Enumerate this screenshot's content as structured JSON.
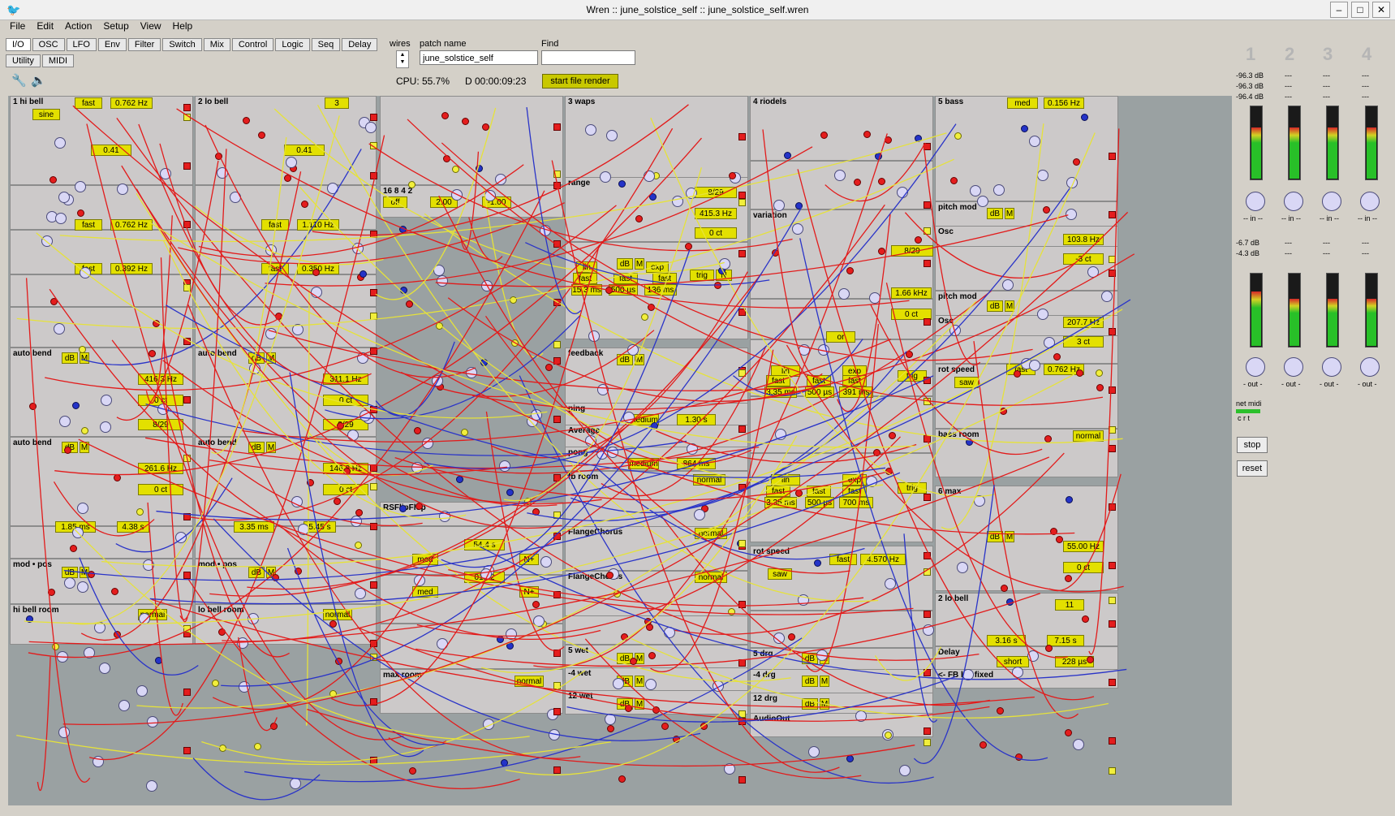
{
  "window": {
    "title": "Wren :: june_solstice_self :: june_solstice_self.wren"
  },
  "menu": [
    "File",
    "Edit",
    "Action",
    "Setup",
    "View",
    "Help"
  ],
  "toolbar": {
    "tabs_row1": [
      "I/O",
      "OSC",
      "LFO",
      "Env",
      "Filter",
      "Switch",
      "Mix",
      "Control",
      "Logic",
      "Seq",
      "Delay"
    ],
    "tabs_row2": [
      "Utility",
      "MIDI"
    ],
    "wires_label": "wires",
    "patch_name_label": "patch name",
    "patch_name_value": "june_solstice_self",
    "find_label": "Find",
    "find_value": "",
    "cpu": "CPU: 55.7%",
    "time": "D 00:00:09:23",
    "render_button": "start file render"
  },
  "modules": [
    {
      "title": "1 hi bell",
      "rate": "fast",
      "freq": "0.762 Hz",
      "wave": "sine",
      "val": "0.41"
    },
    {
      "title": "2 lo bell",
      "trig_val": "3",
      "val": "0.41"
    },
    {
      "title": "16 8 4 2",
      "btn": "off",
      "gain": "2.00",
      "offset": "-1.00"
    },
    {
      "title": "3 waps"
    },
    {
      "title": "4 riodels"
    },
    {
      "title": "5 bass",
      "rate": "med",
      "freq": "0.156 Hz"
    },
    {
      "title": "range"
    },
    {
      "title": "variation"
    },
    {
      "title": "pitch mod"
    },
    {
      "title": "Osc",
      "freq": "103.8 Hz",
      "tune": "-3 ct"
    },
    {
      "title": "pitch mod"
    },
    {
      "title": "Osc",
      "freq": "207.7 Hz",
      "tune": "3 ct"
    },
    {
      "title": "rot speed",
      "rate": "fast",
      "freq": "0.762 Hz",
      "wave": "saw"
    },
    {
      "title": "bass room",
      "mode": "normal"
    },
    {
      "title": "6 max"
    },
    {
      "title": "2 lo bell",
      "trig_val": "11",
      "attack": "3.16 s",
      "release": "7.15 s"
    },
    {
      "title": "Delay",
      "mode": "short",
      "delay": "228 µs"
    },
    {
      "title": "<- FB lev fixed"
    },
    {
      "title": "auto bend",
      "freq": "416.3 Hz",
      "tune": "0 ct",
      "notes": "8/29"
    },
    {
      "title": "auto bend",
      "freq": "311.1 Hz",
      "tune": "0 ct",
      "notes": "8/29"
    },
    {
      "title": "auto bend",
      "freq": "261.6 Hz",
      "tune": "0 ct"
    },
    {
      "title": "auto bend",
      "freq": "146.8 Hz",
      "tune": "0 ct"
    },
    {
      "title": "mod • pos"
    },
    {
      "title": "mod • pos"
    },
    {
      "title": "hi bell room",
      "mode": "normal"
    },
    {
      "title": "lo bell room",
      "mode": "normal"
    },
    {
      "title": "RSFlipFlop"
    },
    {
      "title": "max room",
      "mode": "normal"
    },
    {
      "title": "feedback"
    },
    {
      "title": "ping",
      "mode": "medium",
      "delay": "1.30 s"
    },
    {
      "title": "Average"
    },
    {
      "title": "pong",
      "mode": "medium",
      "delay": "864 ms"
    },
    {
      "title": "fb room",
      "mode": "normal"
    },
    {
      "title": "FlangeChorus",
      "mode": "normal"
    },
    {
      "title": "FlangeChorus",
      "mode": "normal"
    },
    {
      "title": "5 wet"
    },
    {
      "title": "-4 wet"
    },
    {
      "title": "12 wet"
    },
    {
      "title": "5 drg"
    },
    {
      "title": "-4 drg"
    },
    {
      "title": "12 drg"
    },
    {
      "title": "AudioOut"
    },
    {
      "title": "rot speed",
      "rate": "fast",
      "freq": "4.570 Hz",
      "wave": "saw"
    }
  ],
  "labels": {
    "hibell_freq2": "0.762 Hz",
    "hibell_freq3": "0.392 Hz",
    "lobell_freq1": "1.110 Hz",
    "lobell_freq2": "0.350 Hz",
    "lobell_attack": "3.35 ms",
    "lobell_release": "5.45 s",
    "hibell_attack": "1.85 ms",
    "hibell_release": "4.38 s",
    "lfo_time1": "54.4 s",
    "lfo_time2": "01:12",
    "range_notes": "8/29",
    "range_freq": "415.3 Hz",
    "range_tune": "0 ct",
    "env1": [
      "15.3 ms",
      "500 µs",
      "136 ms"
    ],
    "var_freq": "1.66 kHz",
    "var_notes": "8/29",
    "var_tune": "0 ct",
    "env2": [
      "3.35 ms",
      "500 µs",
      "391 ms"
    ],
    "env3": [
      "3.35 ms",
      "500 µs",
      "700 ms"
    ],
    "max_freq": "55.00 Hz",
    "max_tune": "0 ct",
    "steps": "5",
    "steps2": "6",
    "steps3": "3",
    "lin": "lin",
    "exp": "exp",
    "fast": "fast",
    "trig": "trig",
    "N": "N",
    "or": "or",
    "dB": "dB",
    "M": "M",
    "sine": "sine",
    "med": "med",
    "Nplus": "N+"
  },
  "right_panel": {
    "channels": [
      "1",
      "2",
      "3",
      "4"
    ],
    "db_row1": [
      "-96.3 dB",
      "---",
      "---",
      "---"
    ],
    "db_row2": [
      "-96.3 dB",
      "---",
      "---",
      "---"
    ],
    "db_row3": [
      "-96.4 dB",
      "---",
      "---",
      "---"
    ],
    "in_label": "-- in --",
    "db_out1": [
      "-6.7 dB",
      "---",
      "---",
      "---"
    ],
    "db_out2": [
      "-4.3 dB",
      "---",
      "---",
      "---"
    ],
    "out_label": "- out -",
    "net_midi": "net midi",
    "crt": "c r t",
    "stop": "stop",
    "reset": "reset",
    "in_levels": [
      0.7,
      0.7,
      0.7,
      0.7
    ],
    "out_levels": [
      0.75,
      0.65,
      0.65,
      0.65
    ]
  },
  "colors": {
    "canvas": "#9aa1a2",
    "module": "#ccc9c9",
    "yellow": "#e3e000",
    "wire_red": "#e21b1b",
    "wire_blue": "#2a34c8",
    "wire_yellow": "#e6e23a"
  }
}
